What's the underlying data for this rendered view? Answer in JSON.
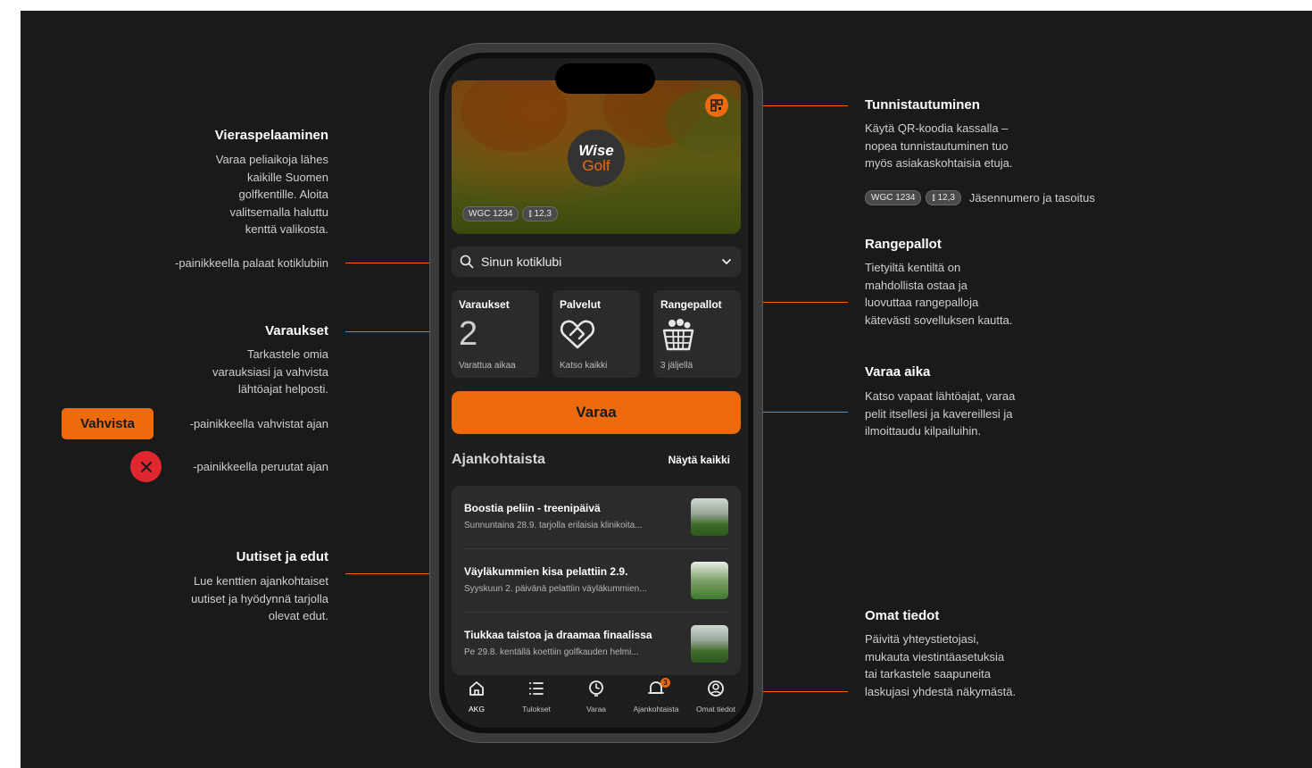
{
  "annotations": {
    "vieraspelaaminen": {
      "title": "Vieraspelaaminen",
      "lines": [
        "Varaa peliaikoja lähes",
        "kaikille Suomen",
        "golfkentille. Aloita",
        "valitsemalla haluttu",
        "kenttä valikosta."
      ]
    },
    "kotiklubi_note": "-painikkeella palaat kotiklubiin",
    "varaukset": {
      "title": "Varaukset",
      "lines": [
        "Tarkastele omia",
        "varauksiasi ja vahvista",
        "lähtöajat helposti."
      ]
    },
    "vahvista_button": "Vahvista",
    "vahvista_note": "-painikkeella vahvistat ajan",
    "peruuta_note": "-painikkeella peruutat ajan",
    "uutiset": {
      "title": "Uutiset ja edut",
      "lines": [
        "Lue kenttien ajankohtaiset",
        "uutiset ja hyödynnä tarjolla",
        "olevat edut."
      ]
    },
    "tunnistautuminen": {
      "title": "Tunnistautuminen",
      "lines": [
        "Käytä QR-koodia kassalla –",
        "nopea tunnistautuminen tuo",
        "myös asiakaskohtaisia etuja."
      ]
    },
    "member_chip": "WGC 1234",
    "handicap_chip": "12,3",
    "member_note": "Jäsennumero ja tasoitus",
    "rangepallot": {
      "title": "Rangepallot",
      "lines": [
        "Tietyiltä kentiltä on",
        "mahdollista ostaa ja",
        "luovuttaa rangepalloja",
        "kätevästi sovelluksen kautta."
      ]
    },
    "varaa_aika": {
      "title": "Varaa aika",
      "lines": [
        "Katso vapaat lähtöajat, varaa",
        "pelit itsellesi ja kavereillesi ja",
        "ilmoittaudu kilpailuihin."
      ]
    },
    "omat_tiedot": {
      "title": "Omat tiedot",
      "lines": [
        "Päivitä yhteystietojasi,",
        "mukauta viestintäasetuksia",
        "tai tarkastele saapuneita",
        "laskujasi yhdestä näkymästä."
      ]
    }
  },
  "app": {
    "logo_top": "Wise",
    "logo_bottom": "Golf",
    "member_chip": "WGC 1234",
    "handicap_chip": "12,3",
    "search_placeholder": "Sinun kotiklubi",
    "cards": [
      {
        "title": "Varaukset",
        "value": "2",
        "sub": "Varattua aikaa"
      },
      {
        "title": "Palvelut",
        "sub": "Katso kaikki",
        "icon": "heart-handshake-icon"
      },
      {
        "title": "Rangepallot",
        "sub": "3 jäljellä",
        "icon": "range-basket-icon"
      }
    ],
    "book_button": "Varaa",
    "news_heading": "Ajankohtaista",
    "news_see_all": "Näytä kaikki",
    "news": [
      {
        "title": "Boostia peliin - treenipäivä",
        "summary": "Sunnuntaina 28.9. tarjolla erilaisia klinikoita..."
      },
      {
        "title": "Väyläkummien kisa pelattiin 2.9.",
        "summary": "Syyskuun 2. päivänä pelattiin väyläkummien..."
      },
      {
        "title": "Tiukkaa taistoa ja draamaa finaalissa",
        "summary": "Pe 29.8. kentällä koettiin golfkauden helmi..."
      }
    ],
    "tabs": [
      {
        "label": "AKG",
        "icon": "home-icon"
      },
      {
        "label": "Tulokset",
        "icon": "list-icon"
      },
      {
        "label": "Varaa",
        "icon": "clock-icon"
      },
      {
        "label": "Ajankohtaista",
        "icon": "bell-icon",
        "badge": "3"
      },
      {
        "label": "Omat tiedot",
        "icon": "user-icon"
      }
    ]
  },
  "colors": {
    "accent": "#ee6a0f",
    "background": "#1a1a1a",
    "danger": "#e0262e"
  }
}
